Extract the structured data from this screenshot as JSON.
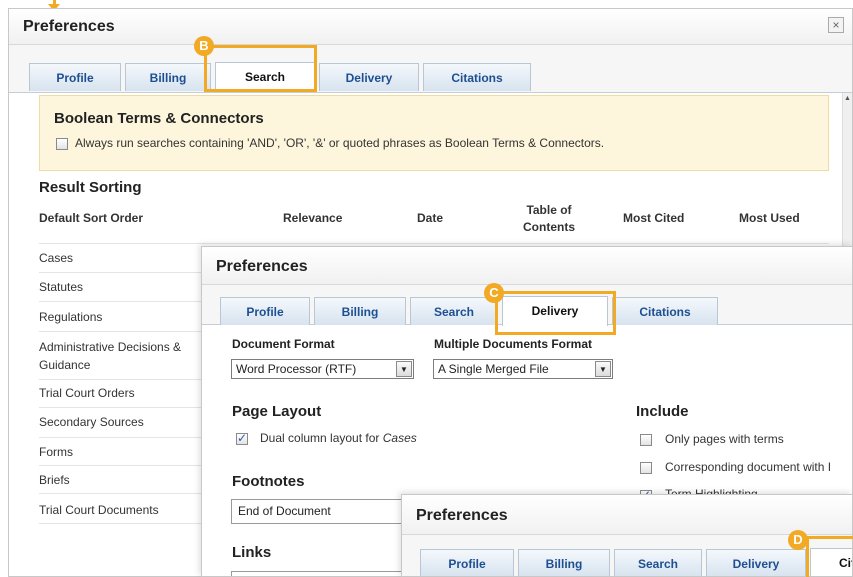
{
  "dialog1": {
    "title": "Preferences",
    "close_label": "×",
    "tabs": [
      "Profile",
      "Billing",
      "Search",
      "Delivery",
      "Citations"
    ],
    "callout": "B",
    "boolean_section": {
      "heading": "Boolean Terms & Connectors",
      "checkbox_label": "Always run searches containing 'AND', 'OR', '&' or quoted phrases as Boolean Terms & Connectors."
    },
    "result_sorting": {
      "heading": "Result Sorting",
      "columns": [
        "Default Sort Order",
        "Relevance",
        "Date",
        "Table of Contents",
        "Most Cited",
        "Most Used"
      ],
      "rows": [
        "Cases",
        "Statutes",
        "Regulations",
        "Administrative Decisions & Guidance",
        "Trial Court Orders",
        "Secondary Sources",
        "Forms",
        "Briefs",
        "Trial Court Documents"
      ]
    }
  },
  "dialog2": {
    "title": "Preferences",
    "tabs": [
      "Profile",
      "Billing",
      "Search",
      "Delivery",
      "Citations"
    ],
    "callout": "C",
    "document_format": {
      "label": "Document Format",
      "value": "Word Processor (RTF)"
    },
    "multiple_format": {
      "label": "Multiple Documents Format",
      "value": "A Single Merged File"
    },
    "page_layout": {
      "heading": "Page Layout",
      "checkbox_label": "Dual column layout for ",
      "checkbox_label_em": "Cases"
    },
    "include": {
      "heading": "Include",
      "items": [
        "Only pages with terms",
        "Corresponding document with I",
        "Term Highlighting"
      ]
    },
    "footnotes": {
      "heading": "Footnotes",
      "value": "End of Document"
    },
    "links": {
      "heading": "Links"
    }
  },
  "dialog3": {
    "title": "Preferences",
    "tabs": [
      "Profile",
      "Billing",
      "Search",
      "Delivery",
      "Cit"
    ],
    "callout": "D"
  }
}
